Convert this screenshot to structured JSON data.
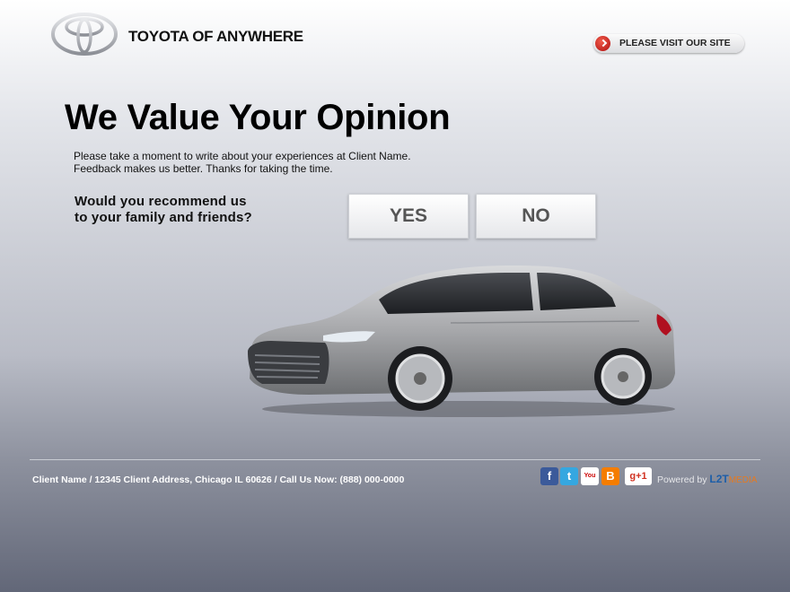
{
  "header": {
    "brand_name": "TOYOTA OF ANYWHERE",
    "visit_label": "PLEASE VISIT OUR SITE"
  },
  "main": {
    "title": "We Value Your Opinion",
    "intro_line1": "Please take a moment to write about your experiences at Client Name.",
    "intro_line2": "Feedback makes us better. Thanks for taking the time.",
    "question_line1": "Would you recommend us",
    "question_line2": "to your family and friends?",
    "yes_label": "YES",
    "no_label": "NO"
  },
  "footer": {
    "address": "Client Name / 12345 Client Address, Chicago IL 60626 / Call Us Now: (888) 000-0000",
    "powered_by": "Powered by",
    "l2t": "L2T",
    "media": "MEDIA",
    "social": [
      {
        "name": "facebook-icon",
        "glyph": "f"
      },
      {
        "name": "twitter-icon",
        "glyph": "t"
      },
      {
        "name": "youtube-icon",
        "glyph": "You"
      },
      {
        "name": "blogger-icon",
        "glyph": "B"
      },
      {
        "name": "google-plus-icon",
        "glyph": "g+1"
      }
    ]
  },
  "colors": {
    "accent_red": "#c0171d",
    "brand_blue": "#1d5ea8",
    "brand_orange": "#e57a21"
  }
}
